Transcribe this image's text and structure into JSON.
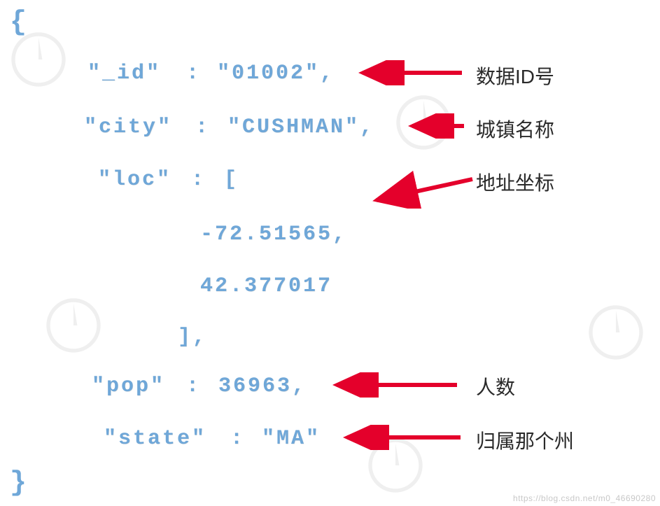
{
  "braces": {
    "open": "{",
    "close": "}"
  },
  "json": {
    "id_key": "\"_id\"",
    "id_sep": " : ",
    "id_val": "\"01002\",",
    "city_key": "\"city\"",
    "city_sep": " : ",
    "city_val": "\"CUSHMAN\",",
    "loc_key": "\"loc\"",
    "loc_sep": " : ",
    "loc_open": "[",
    "loc_v1": "-72.51565,",
    "loc_v2": "42.377017",
    "loc_close": "],",
    "pop_key": "\"pop\"",
    "pop_sep": " : ",
    "pop_val": "36963,",
    "state_key": "\"state\"",
    "state_sep": " : ",
    "state_val": "\"MA\""
  },
  "annotations": {
    "id": "数据ID号",
    "city": "城镇名称",
    "loc": "地址坐标",
    "pop": "人数",
    "state": "归属那个州"
  },
  "arrows": {
    "color": "#e4002b"
  },
  "watermark": {
    "url": "https://blog.csdn.net/m0_46690280"
  }
}
